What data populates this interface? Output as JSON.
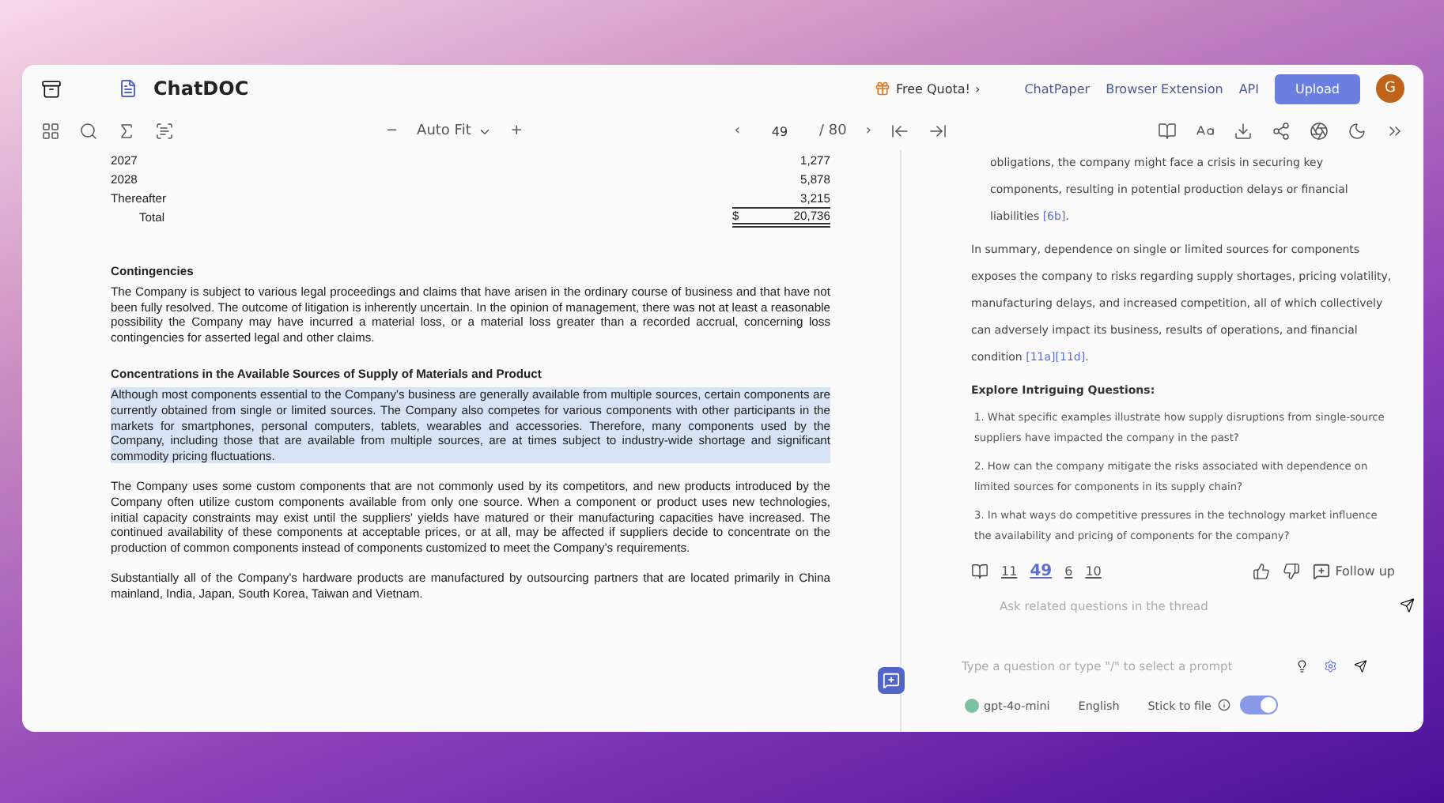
{
  "header": {
    "logo": "ChatDOC",
    "quota": "Free Quota!",
    "quota_caret": "›",
    "links": [
      "ChatPaper",
      "Browser Extension",
      "API"
    ],
    "upload": "Upload",
    "avatar": "G"
  },
  "toolbar": {
    "zoom_out": "−",
    "zoom": "Auto Fit",
    "zoom_in": "+",
    "prev": "‹",
    "page": "49",
    "total": "/ 80",
    "next": "›"
  },
  "document": {
    "rows": [
      {
        "label": "2027",
        "value": "1,277"
      },
      {
        "label": "2028",
        "value": "5,878"
      },
      {
        "label": "Thereafter",
        "value": "3,215"
      }
    ],
    "total": {
      "label": "Total",
      "currency": "$",
      "value": "20,736"
    },
    "sections": [
      {
        "heading": "Contingencies",
        "paragraphs": [
          {
            "text": "The Company is subject to various legal proceedings and claims that have arisen in the ordinary course of business and that have not been fully resolved. The outcome of litigation is inherently uncertain. In the opinion of management, there was not at least a reasonable possibility the Company may have incurred a material loss, or a material loss greater than a recorded accrual, concerning loss contingencies for asserted legal and other claims.",
            "highlighted": false
          }
        ]
      },
      {
        "heading": "Concentrations in the Available Sources of Supply of Materials and Product",
        "paragraphs": [
          {
            "text": "Although most components essential to the Company's business are generally available from multiple sources, certain components are currently obtained from single or limited sources. The Company also competes for various components with other participants in the markets for smartphones, personal computers, tablets, wearables and accessories. Therefore, many components used by the Company, including those that are available from multiple sources, are at times subject to industry-wide shortage and significant commodity pricing fluctuations.",
            "highlighted": true
          },
          {
            "text": "The Company uses some custom components that are not commonly used by its competitors, and new products introduced by the Company often utilize custom components available from only one source. When a component or product uses new technologies, initial capacity constraints may exist until the suppliers' yields have matured or their manufacturing capacities have increased. The continued availability of these components at acceptable prices, or at all, may be affected if suppliers decide to concentrate on the production of common components instead of components customized to meet the Company's requirements.",
            "highlighted": false
          },
          {
            "text": "Substantially all of the Company's hardware products are manufactured by outsourcing partners that are located primarily in China mainland, India, Japan, South Korea, Taiwan and Vietnam.",
            "highlighted": false
          }
        ]
      }
    ]
  },
  "chat": {
    "answer": [
      {
        "indented": true,
        "segments": [
          {
            "kind": "text",
            "text": "obligations, the company might face a crisis in securing key components, resulting in potential production delays or financial liabilities "
          },
          {
            "kind": "cite",
            "text": "[6b]"
          },
          {
            "kind": "text",
            "text": "."
          }
        ]
      },
      {
        "indented": false,
        "segments": [
          {
            "kind": "text",
            "text": "In summary, dependence on single or limited sources for components exposes the company to risks regarding supply shortages, pricing volatility, manufacturing delays, and increased competition, all of which collectively can adversely impact its business, results of operations, and financial condition "
          },
          {
            "kind": "cite",
            "text": "[11a]"
          },
          {
            "kind": "cite",
            "text": "[11d]"
          },
          {
            "kind": "text",
            "text": "."
          }
        ]
      }
    ],
    "explore_heading": "Explore Intriguing Questions:",
    "questions": [
      "1. What specific examples illustrate how supply disruptions from single-source suppliers have impacted the company in the past?",
      "2. How can the company mitigate the risks associated with dependence on limited sources for components in its supply chain?",
      "3. In what ways do competitive pressures in the technology market influence the availability and pricing of components for the company?"
    ],
    "refs": [
      {
        "label": "11",
        "selected": false
      },
      {
        "label": "49",
        "selected": true
      },
      {
        "label": "6",
        "selected": false
      },
      {
        "label": "10",
        "selected": false
      }
    ],
    "follow_up": "Follow up",
    "thread_placeholder": "Ask related questions in the thread",
    "input_placeholder": "Type a question or type \"/\" to select a prompt",
    "model": "gpt-4o-mini",
    "language": "English",
    "stick_label": "Stick to file",
    "stick_on": true
  }
}
